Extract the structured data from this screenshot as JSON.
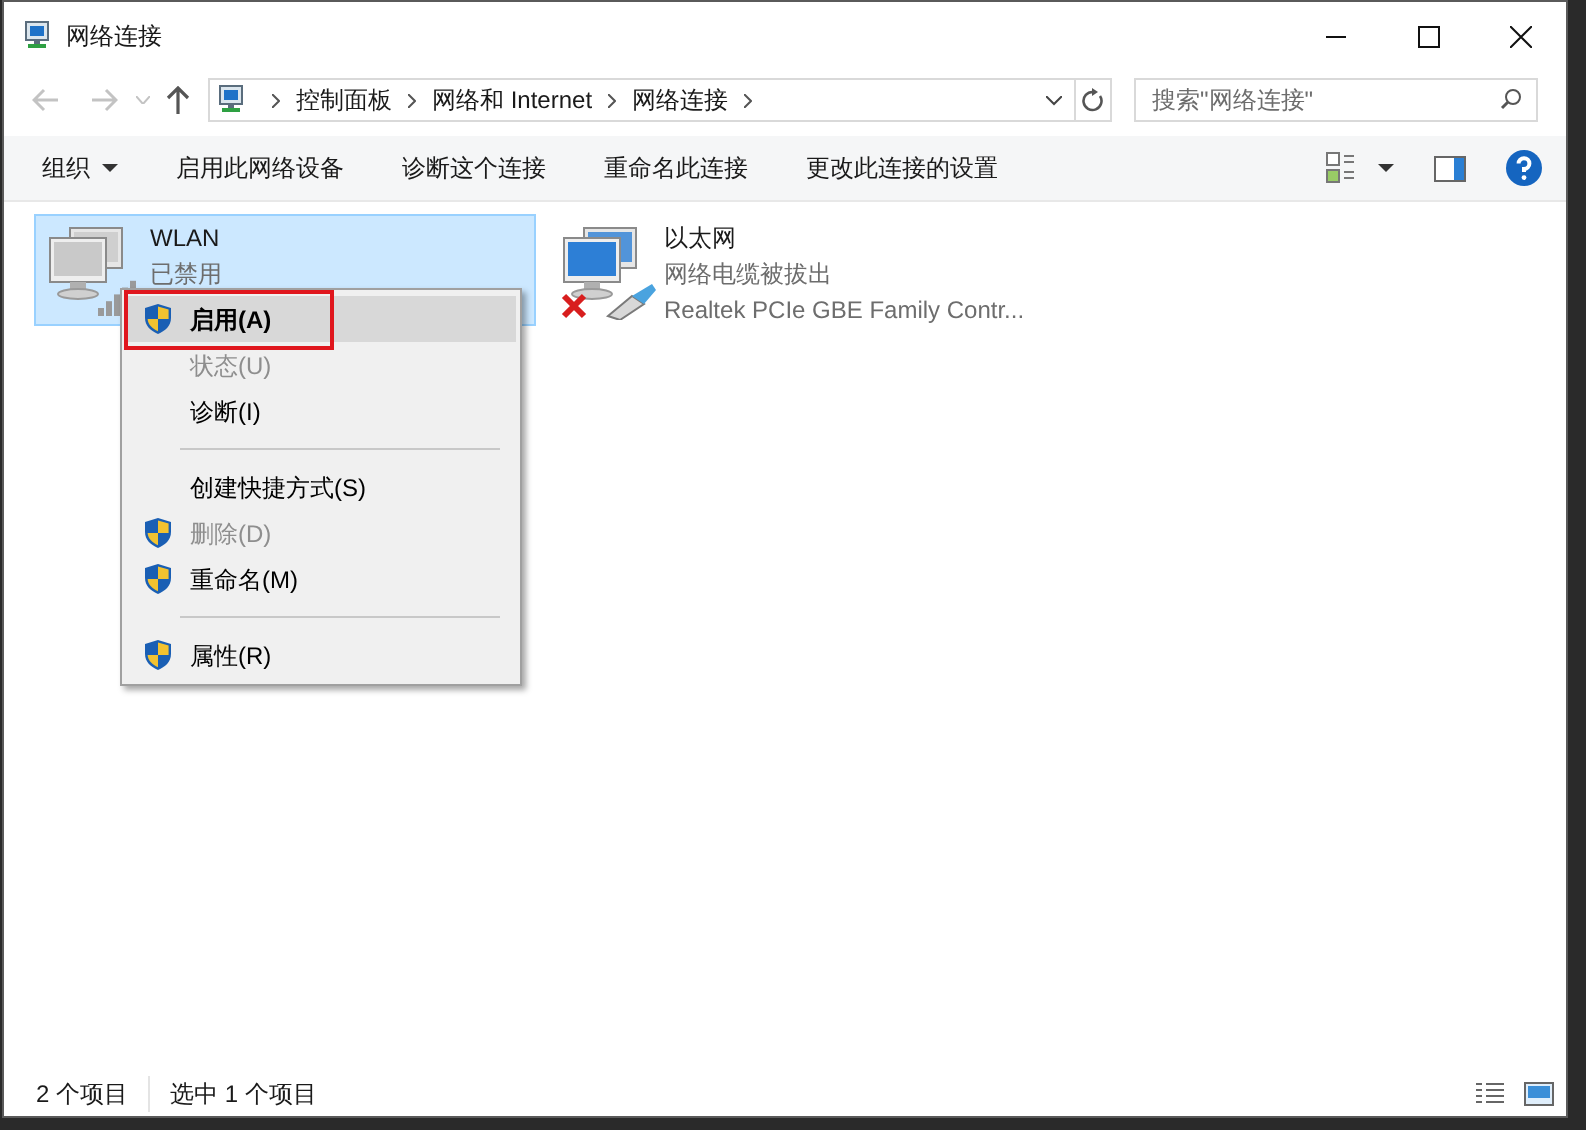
{
  "window": {
    "title": "网络连接"
  },
  "address": {
    "path": [
      "控制面板",
      "网络和 Internet",
      "网络连接"
    ]
  },
  "search": {
    "placeholder": "搜索\"网络连接\""
  },
  "toolbar": {
    "items": [
      {
        "label": "组织",
        "dropdown": true
      },
      {
        "label": "启用此网络设备",
        "dropdown": false
      },
      {
        "label": "诊断这个连接",
        "dropdown": false
      },
      {
        "label": "重命名此连接",
        "dropdown": false
      },
      {
        "label": "更改此连接的设置",
        "dropdown": false
      }
    ]
  },
  "connections": [
    {
      "name": "WLAN",
      "status": "已禁用",
      "kind": "wireless",
      "selected": true,
      "disconnected": false
    },
    {
      "name": "以太网",
      "status": "网络电缆被拔出",
      "device": "Realtek PCIe GBE Family Contr...",
      "kind": "ethernet",
      "selected": false,
      "disconnected": true
    }
  ],
  "context_menu": {
    "items": [
      {
        "kind": "item",
        "label": "启用(A)",
        "shield": true,
        "disabled": false,
        "default": true,
        "selected": true,
        "outlined": true
      },
      {
        "kind": "item",
        "label": "状态(U)",
        "shield": false,
        "disabled": true,
        "default": false,
        "selected": false,
        "outlined": false
      },
      {
        "kind": "item",
        "label": "诊断(I)",
        "shield": false,
        "disabled": false,
        "default": false,
        "selected": false,
        "outlined": false
      },
      {
        "kind": "separator"
      },
      {
        "kind": "item",
        "label": "创建快捷方式(S)",
        "shield": false,
        "disabled": false,
        "default": false,
        "selected": false,
        "outlined": false
      },
      {
        "kind": "item",
        "label": "删除(D)",
        "shield": true,
        "disabled": true,
        "default": false,
        "selected": false,
        "outlined": false
      },
      {
        "kind": "item",
        "label": "重命名(M)",
        "shield": true,
        "disabled": false,
        "default": false,
        "selected": false,
        "outlined": false
      },
      {
        "kind": "separator"
      },
      {
        "kind": "item",
        "label": "属性(R)",
        "shield": true,
        "disabled": false,
        "default": false,
        "selected": false,
        "outlined": false
      }
    ]
  },
  "status_bar": {
    "items": [
      "2 个项目",
      "选中 1 个项目"
    ]
  }
}
